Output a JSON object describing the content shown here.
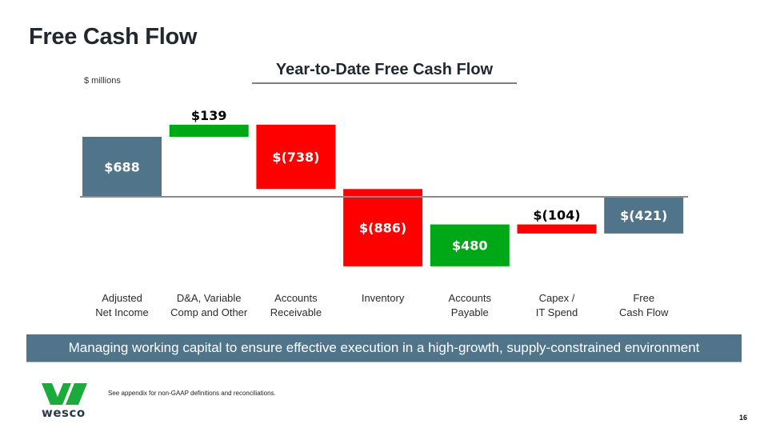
{
  "page": {
    "title": "Free Cash Flow",
    "banner": "Managing working capital to ensure effective execution in a high-growth, supply-constrained environment",
    "footnote": "See appendix for non-GAAP definitions and reconciliations.",
    "page_number": "16",
    "logo_text": "wesco",
    "logo_icon": "wesco-w-logo-icon"
  },
  "colors": {
    "total": "#50758a",
    "increase": "#00a818",
    "decrease": "#ff0000",
    "baseline": "#8c8c8c",
    "logo_green": "#1aab3c"
  },
  "chart_data": {
    "type": "waterfall",
    "title": "Year-to-Date Free Cash Flow",
    "units_label": "$ millions",
    "xlabel": "",
    "ylabel": "",
    "grid": false,
    "legend": "none",
    "ylim": [
      -900,
      900
    ],
    "categories": [
      [
        "Adjusted",
        "Net Income"
      ],
      [
        "D&A, Variable",
        "Comp and Other"
      ],
      [
        "Accounts",
        "Receivable"
      ],
      [
        "Inventory"
      ],
      [
        "Accounts",
        "Payable"
      ],
      [
        "Capex /",
        "IT Spend"
      ],
      [
        "Free",
        "Cash Flow"
      ]
    ],
    "bars": [
      {
        "kind": "total",
        "value": 688,
        "label": "$688",
        "label_position": "inside"
      },
      {
        "kind": "increase",
        "value": 139,
        "label": "$139",
        "label_position": "above"
      },
      {
        "kind": "decrease",
        "value": -738,
        "label": "$(738)",
        "label_position": "inside"
      },
      {
        "kind": "decrease",
        "value": -886,
        "label": "$(886)",
        "label_position": "inside"
      },
      {
        "kind": "increase",
        "value": 480,
        "label": "$480",
        "label_position": "inside"
      },
      {
        "kind": "decrease",
        "value": -104,
        "label": "$(104)",
        "label_position": "above"
      },
      {
        "kind": "total",
        "value": -421,
        "label": "$(421)",
        "label_position": "inside"
      }
    ]
  }
}
